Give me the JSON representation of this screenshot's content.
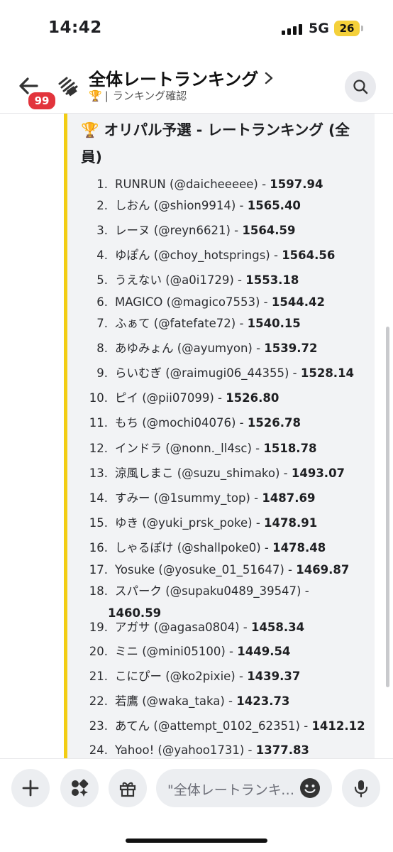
{
  "status_bar": {
    "time": "14:42",
    "network": "5G",
    "battery": "26"
  },
  "header": {
    "title": "全体レートランキング",
    "subtitle": "ランキング確認",
    "subtitle_icon": "🏆",
    "subtitle_separator": "|",
    "notification_count": "99",
    "icons": [
      "back-arrow-icon",
      "channel-icon",
      "chevron-right-icon",
      "search-icon"
    ]
  },
  "embed": {
    "title": "🏆 オリパル予選 - レートランキング (全員)",
    "accent_color": "#f2cd14",
    "entries": [
      {
        "rank": "1.",
        "name": "RUNRUN (@daicheeeee) - ",
        "score": "1597.94"
      },
      {
        "rank": "2.",
        "name": "しおん (@shion9914) - ",
        "score": "1565.40"
      },
      {
        "rank": "3.",
        "name": "レーヌ (@reyn6621) - ",
        "score": "1564.59"
      },
      {
        "rank": "4.",
        "name": "ゆぽん (@choy_hotsprings) - ",
        "score": "1564.56"
      },
      {
        "rank": "5.",
        "name": "うえない (@a0i1729) - ",
        "score": "1553.18"
      },
      {
        "rank": "6.",
        "name": "MAGICO (@magico7553) - ",
        "score": "1544.42"
      },
      {
        "rank": "7.",
        "name": "ふぁて (@fatefate72) - ",
        "score": "1540.15"
      },
      {
        "rank": "8.",
        "name": "あゆみょん (@ayumyon) - ",
        "score": "1539.72"
      },
      {
        "rank": "9.",
        "name": "らいむぎ (@raimugi06_44355) - ",
        "score": "1528.14"
      },
      {
        "rank": "10.",
        "name": "ピイ (@pii07099) - ",
        "score": "1526.80"
      },
      {
        "rank": "11.",
        "name": "もち (@mochi04076) - ",
        "score": "1526.78"
      },
      {
        "rank": "12.",
        "name": "インドラ (@nonn._ll4sc) - ",
        "score": "1518.78"
      },
      {
        "rank": "13.",
        "name": "涼風しまこ (@suzu_shimako) - ",
        "score": "1493.07"
      },
      {
        "rank": "14.",
        "name": "すみー (@1summy_top) - ",
        "score": "1487.69"
      },
      {
        "rank": "15.",
        "name": "ゆき (@yuki_prsk_poke) - ",
        "score": "1478.91"
      },
      {
        "rank": "16.",
        "name": "しゃるぽけ (@shallpoke0) - ",
        "score": "1478.48"
      },
      {
        "rank": "17.",
        "name": "Yosuke (@yosuke_01_51647) - ",
        "score": "1469.87"
      },
      {
        "rank": "18.",
        "name": "スパーク (@supaku0489_39547) -",
        "score": "1460.59"
      },
      {
        "rank": "19.",
        "name": "アガサ (@agasa0804) - ",
        "score": "1458.34"
      },
      {
        "rank": "20.",
        "name": "ミニ (@mini05100) - ",
        "score": "1449.54"
      },
      {
        "rank": "21.",
        "name": "こにぴー (@ko2pixie) - ",
        "score": "1439.37"
      },
      {
        "rank": "22.",
        "name": "若鷹 (@waka_taka) - ",
        "score": "1423.73"
      },
      {
        "rank": "23.",
        "name": "あてん (@attempt_0102_62351) - ",
        "score": "1412.12"
      },
      {
        "rank": "24.",
        "name": "Yahoo! (@yahoo1731) - ",
        "score": "1377.83"
      }
    ]
  },
  "composer": {
    "placeholder": "\"全体レートランキング\"へメッセージを送信",
    "buttons": [
      "plus-icon",
      "apps-icon",
      "gift-icon",
      "emoji-icon",
      "microphone-icon"
    ]
  }
}
